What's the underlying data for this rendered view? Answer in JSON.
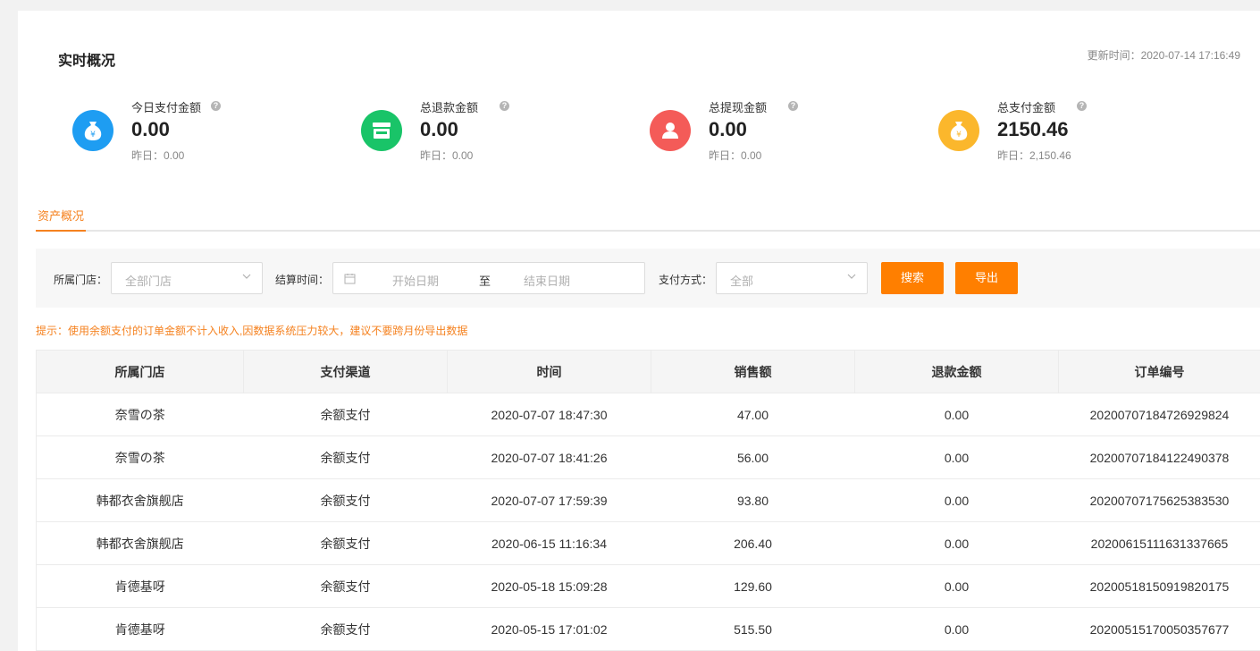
{
  "header": {
    "title": "实时概况",
    "update_time": "更新时间：2020-07-14 17:16:49"
  },
  "stats": [
    {
      "label": "今日支付金额",
      "value": "0.00",
      "yesterday": "昨日：0.00",
      "color": "#1e9df2",
      "icon": "money-bag-icon"
    },
    {
      "label": "总退款金额",
      "value": "0.00",
      "yesterday": "昨日：0.00",
      "color": "#19c468",
      "icon": "store-icon"
    },
    {
      "label": "总提现金额",
      "value": "0.00",
      "yesterday": "昨日：0.00",
      "color": "#f45b58",
      "icon": "user-icon"
    },
    {
      "label": "总支付金额",
      "value": "2150.46",
      "yesterday": "昨日：2,150.46",
      "color": "#fbb72c",
      "icon": "money-bag-icon"
    }
  ],
  "help_glyph": "?",
  "tabs": [
    {
      "label": "资产概况",
      "active": true
    }
  ],
  "filters": {
    "store_label": "所属门店：",
    "store_placeholder": "全部门店",
    "settle_label": "结算时间：",
    "start_placeholder": "开始日期",
    "range_separator": "至",
    "end_placeholder": "结束日期",
    "pay_label": "支付方式：",
    "pay_placeholder": "全部",
    "search_button": "搜索",
    "export_button": "导出"
  },
  "tip": "提示：使用余额支付的订单金额不计入收入,因数据系统压力较大，建议不要跨月份导出数据",
  "table": {
    "columns": [
      "所属门店",
      "支付渠道",
      "时间",
      "销售额",
      "退款金额",
      "订单编号"
    ],
    "rows": [
      [
        "奈雪の茶",
        "余额支付",
        "2020-07-07 18:47:30",
        "47.00",
        "0.00",
        "20200707184726929824"
      ],
      [
        "奈雪の茶",
        "余额支付",
        "2020-07-07 18:41:26",
        "56.00",
        "0.00",
        "20200707184122490378"
      ],
      [
        "韩都衣舍旗舰店",
        "余额支付",
        "2020-07-07 17:59:39",
        "93.80",
        "0.00",
        "20200707175625383530"
      ],
      [
        "韩都衣舍旗舰店",
        "余额支付",
        "2020-06-15 11:16:34",
        "206.40",
        "0.00",
        "20200615111631337665"
      ],
      [
        "肯德基呀",
        "余额支付",
        "2020-05-18 15:09:28",
        "129.60",
        "0.00",
        "20200518150919820175"
      ],
      [
        "肯德基呀",
        "余额支付",
        "2020-05-15 17:01:02",
        "515.50",
        "0.00",
        "20200515170050357677"
      ]
    ]
  },
  "colors": {
    "accent": "#ff7f00",
    "tab_active": "#f58220"
  }
}
